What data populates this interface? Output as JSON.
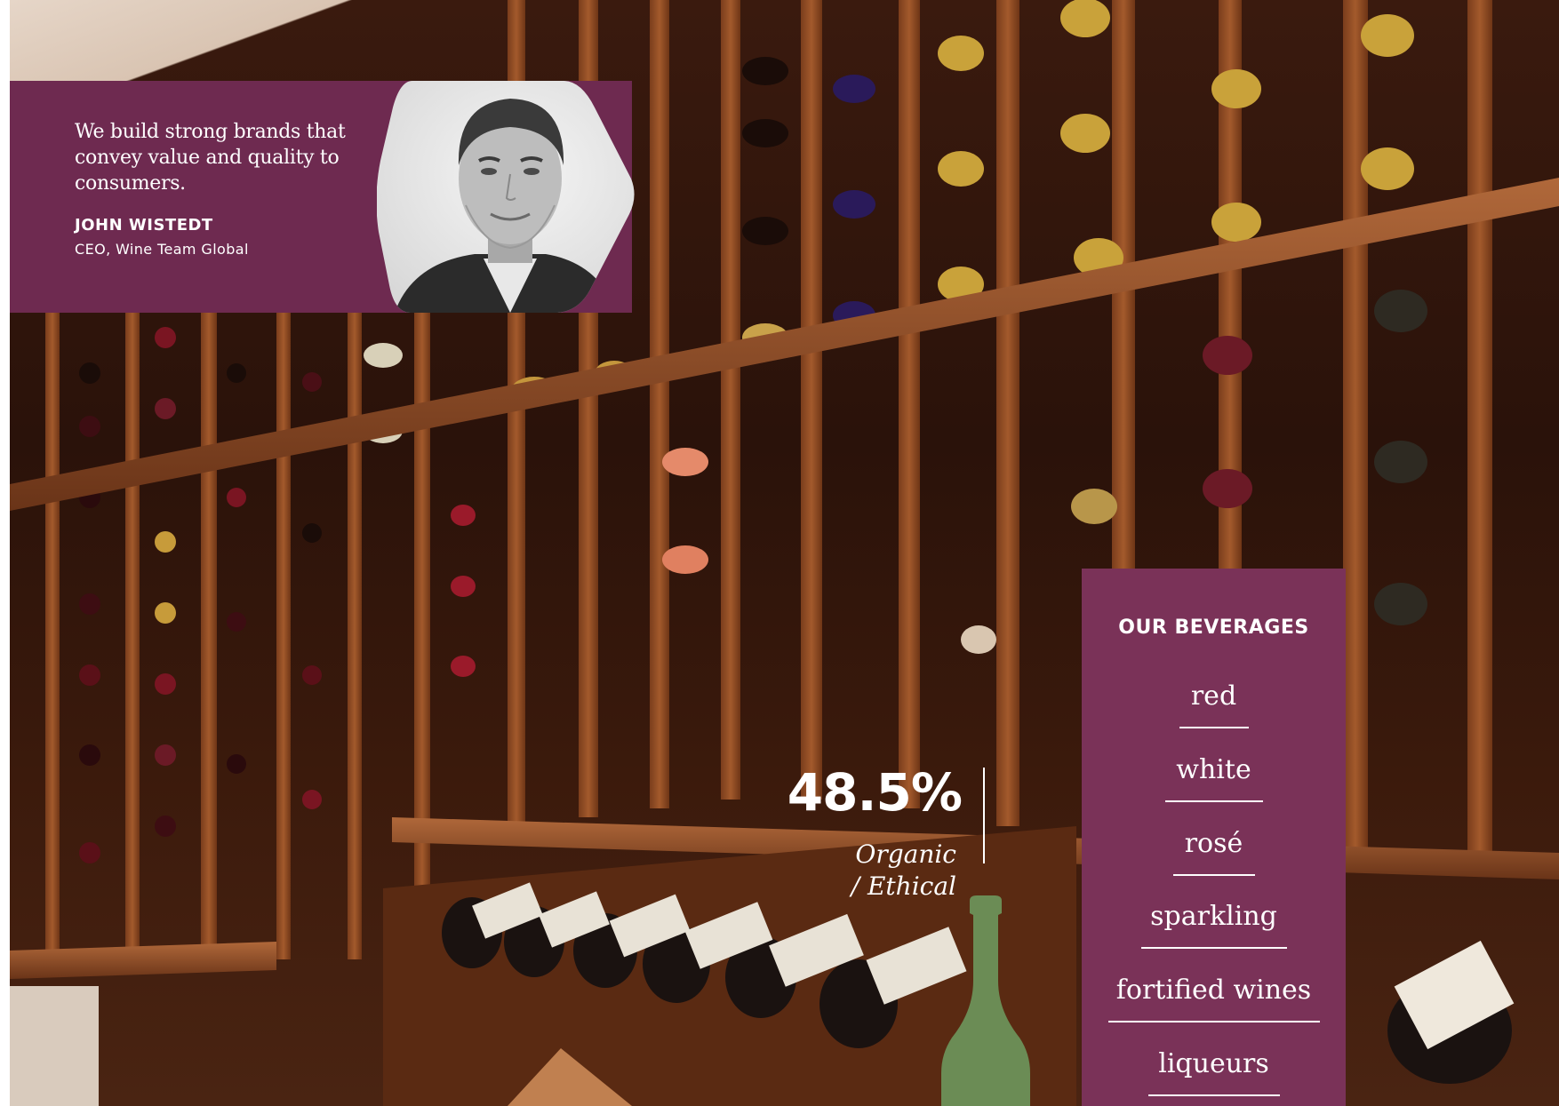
{
  "quote": {
    "text": "We build strong brands that convey value and quality to consumers.",
    "name": "JOHN WISTEDT",
    "title": "CEO, Wine Team Global"
  },
  "statistic": {
    "value": "48.5%",
    "label_line1": "Organic",
    "label_line2": "/ Ethical"
  },
  "beverages": {
    "heading": "OUR BEVERAGES",
    "items": [
      "red",
      "white",
      "rosé",
      "sparkling",
      "fortified wines",
      "liqueurs"
    ]
  },
  "colors": {
    "brand_plum": "#6e2a50",
    "panel_plum": "#7a3258",
    "bottle_green": "#6b8c55"
  }
}
